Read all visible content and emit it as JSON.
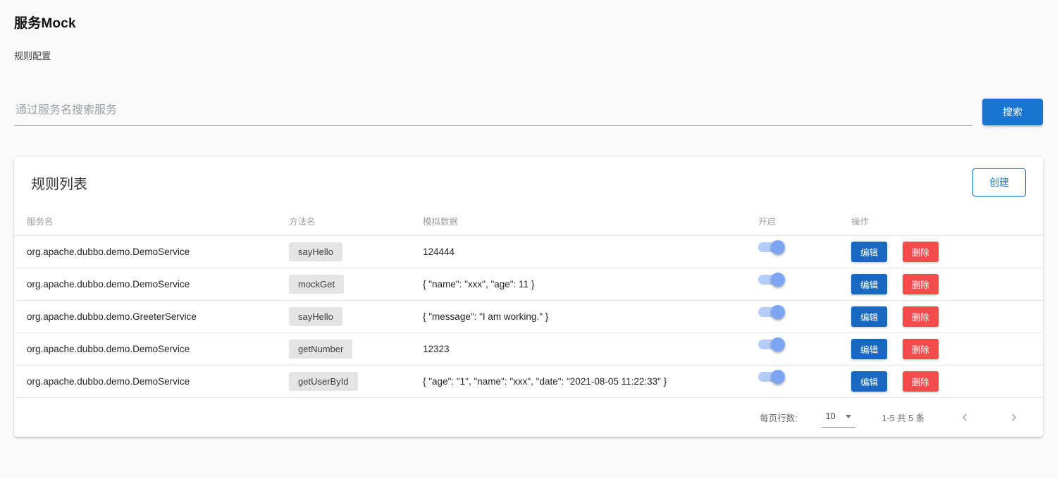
{
  "page": {
    "title": "服务Mock",
    "subtitle": "规则配置"
  },
  "search": {
    "placeholder": "通过服务名搜索服务",
    "button_label": "搜索"
  },
  "card": {
    "title": "规则列表",
    "create_button_label": "创建",
    "table": {
      "columns": [
        "服务名",
        "方法名",
        "模拟数据",
        "开启",
        "操作"
      ],
      "rows": [
        {
          "service": "org.apache.dubbo.demo.DemoService",
          "method": "sayHello",
          "mock_data": "124444",
          "enabled": true
        },
        {
          "service": "org.apache.dubbo.demo.DemoService",
          "method": "mockGet",
          "mock_data": "{ \"name\": \"xxx\", \"age\": 11 }",
          "enabled": true
        },
        {
          "service": "org.apache.dubbo.demo.GreeterService",
          "method": "sayHello",
          "mock_data": "{ \"message\": \"I am working.\" }",
          "enabled": true
        },
        {
          "service": "org.apache.dubbo.demo.DemoService",
          "method": "getNumber",
          "mock_data": "12323",
          "enabled": true
        },
        {
          "service": "org.apache.dubbo.demo.DemoService",
          "method": "getUserById",
          "mock_data": "{ \"age\": \"1\", \"name\": \"xxx\", \"date\": \"2021-08-05 11:22:33\" }",
          "enabled": true
        }
      ],
      "actions": {
        "edit_label": "编辑",
        "delete_label": "删除"
      }
    },
    "pagination": {
      "rows_per_page_label": "每页行数:",
      "rows_per_page_value": "10",
      "range_text": "1-5 共 5 条"
    }
  },
  "icons": {
    "rows_per_page_caret": "caret-down-icon",
    "prev": "chevron-left-icon",
    "next": "chevron-right-icon"
  },
  "colors": {
    "primary_blue": "#1976d2",
    "edit_blue": "#1867c0",
    "delete_red": "#f44c4c",
    "toggle_thumb": "#7da6f2",
    "toggle_track": "#b3ccf8",
    "chip_bg": "#e4e4e4"
  }
}
